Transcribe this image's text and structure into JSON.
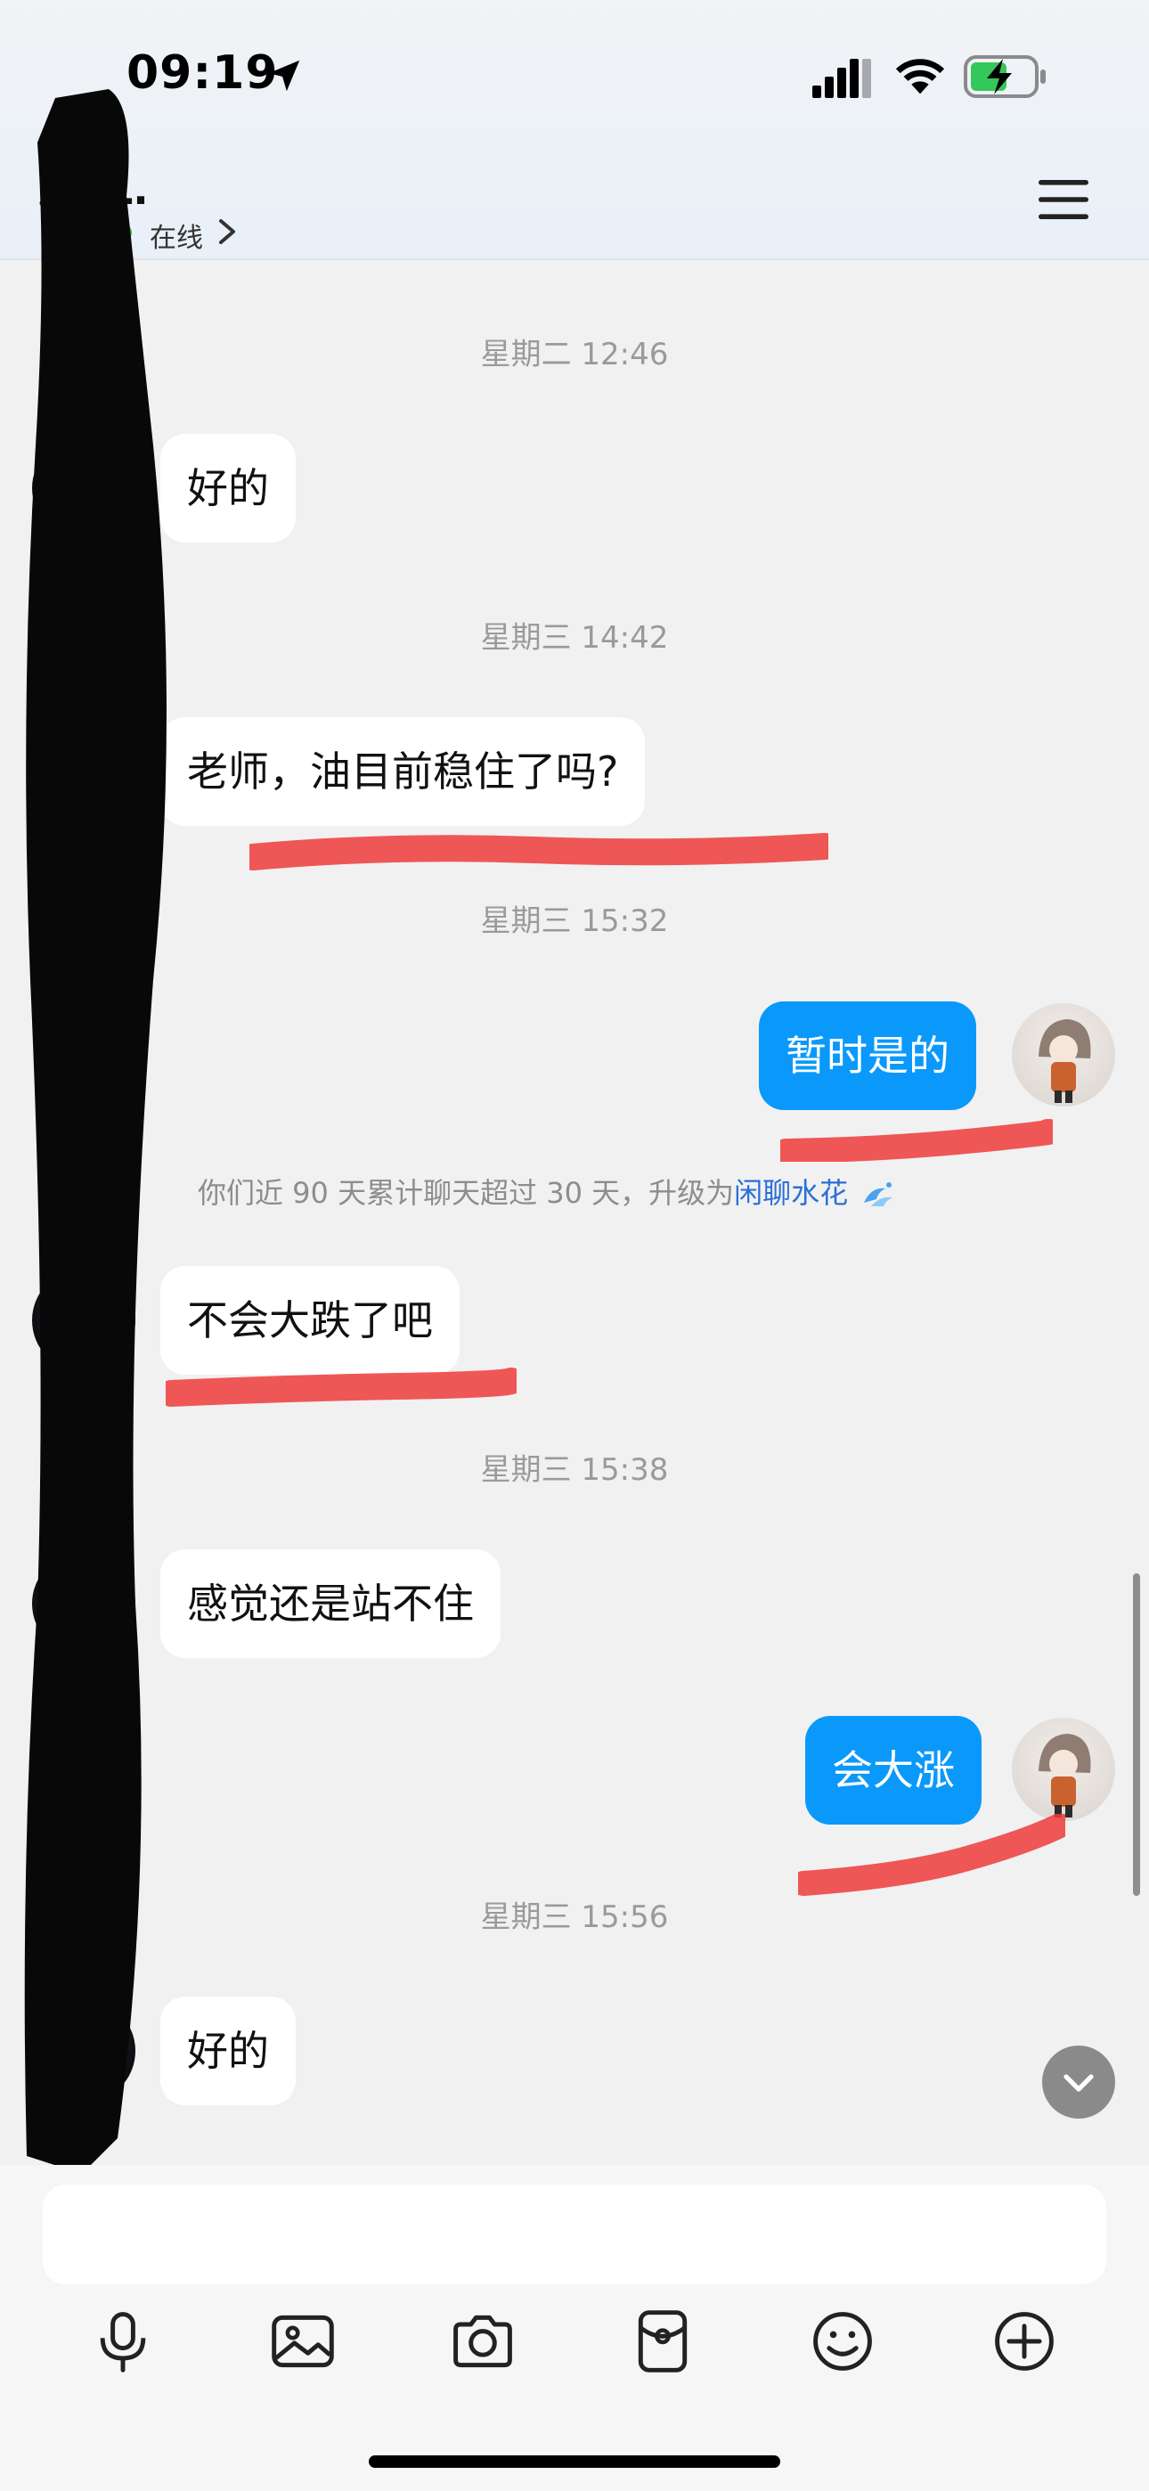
{
  "status_bar": {
    "time": "09:19"
  },
  "header": {
    "contact_name": "L.",
    "online_status": "在线"
  },
  "messages": [
    {
      "type": "timestamp",
      "text": "星期二 12:46"
    },
    {
      "type": "incoming",
      "text": "好的"
    },
    {
      "type": "timestamp",
      "text": "星期三 14:42"
    },
    {
      "type": "incoming",
      "text": "老师，油目前稳住了吗?"
    },
    {
      "type": "timestamp",
      "text": "星期三 15:32"
    },
    {
      "type": "outgoing",
      "text": "暂时是的"
    },
    {
      "type": "system",
      "text": "你们近 90 天累计聊天超过 30 天，升级为",
      "highlight": "闲聊水花"
    },
    {
      "type": "incoming",
      "text": "不会大跌了吧"
    },
    {
      "type": "timestamp",
      "text": "星期三 15:38"
    },
    {
      "type": "incoming",
      "text": "感觉还是站不住"
    },
    {
      "type": "outgoing",
      "text": "会大涨"
    },
    {
      "type": "timestamp",
      "text": "星期三 15:56"
    },
    {
      "type": "incoming",
      "text": "好的"
    }
  ],
  "input": {
    "value": ""
  },
  "toolbar": [
    "microphone-icon",
    "image-icon",
    "camera-icon",
    "red-packet-icon",
    "emoji-icon",
    "plus-icon"
  ],
  "colors": {
    "outgoing_bubble": "#0a99fb",
    "incoming_bubble": "#ffffff",
    "background": "#f1f1f1",
    "link": "#2a6fd6"
  }
}
